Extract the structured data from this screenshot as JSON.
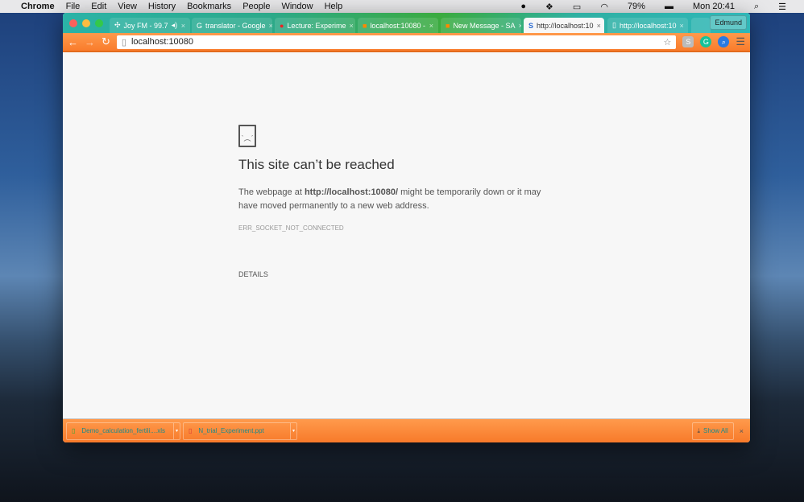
{
  "menubar": {
    "app": "Chrome",
    "items": [
      "File",
      "Edit",
      "View",
      "History",
      "Bookmarks",
      "People",
      "Window",
      "Help"
    ],
    "battery": "79%",
    "clock": "Mon 20:41"
  },
  "tabs": [
    {
      "title": "Joy FM - 99.7",
      "icon": "radio-icon"
    },
    {
      "title": "translator - Google",
      "icon": "google-icon"
    },
    {
      "title": "Lecture: Experime",
      "icon": "record-icon"
    },
    {
      "title": "localhost:10080 -",
      "icon": "app-icon"
    },
    {
      "title": "New Message - SA",
      "icon": "app-icon"
    },
    {
      "title": "http://localhost:10",
      "icon": "s-icon",
      "active": true
    },
    {
      "title": "http://localhost:10",
      "icon": "page-icon"
    }
  ],
  "profile": "Edmund",
  "address": "localhost:10080",
  "error": {
    "title": "This site can’t be reached",
    "msg_pre": "The webpage at ",
    "url": "http://localhost:10080/",
    "msg_post": " might be temporarily down or it may have moved permanently to a new web address.",
    "code": "ERR_SOCKET_NOT_CONNECTED",
    "details": "DETAILS"
  },
  "downloads": [
    {
      "name": "Demo_calculation_fertili....xls"
    },
    {
      "name": "N_trial_Experiment.ppt"
    }
  ],
  "show_all": "Show All",
  "close": "×"
}
